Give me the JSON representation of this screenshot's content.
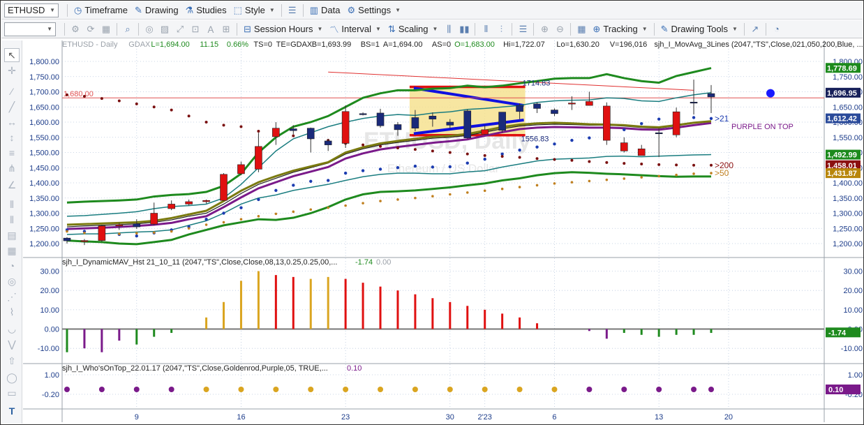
{
  "toolbar1": {
    "symbol": "ETHUSD",
    "timeframe": "Timeframe",
    "drawing": "Drawing",
    "studies": "Studies",
    "style": "Style",
    "data": "Data",
    "settings": "Settings"
  },
  "toolbar2": {
    "session_hours": "Session Hours",
    "interval": "Interval",
    "scaling": "Scaling",
    "tracking": "Tracking",
    "drawing_tools": "Drawing Tools"
  },
  "chart_data": {
    "type": "candlestick",
    "header": {
      "symbol": "ETHUSD - Daily",
      "source": "GDAX",
      "last": "L=1,694.00",
      "change": "11.15",
      "change_pct": "0.66%",
      "ts": "TS=0",
      "te": "TE=GDAX",
      "bid": "B=1,693.99",
      "bs": "BS=1",
      "ask": "A=1,694.00",
      "as": "AS=0",
      "open": "O=1,683.00",
      "high": "Hi=1,722.07",
      "low": "Lo=1,630.20",
      "volume": "V=196,016",
      "study": "sjh_I_MovAvg_3Lines (2047,\"TS\",Close,021,050,200,Blue, ..."
    },
    "watermark": "ETHUSD, Daily",
    "watermark_sub": "Ethereum / US Dollar",
    "price_axis": {
      "min": 1200,
      "max": 1800,
      "ticks": [
        "1,800.00",
        "1,750.00",
        "1,700.00",
        "1,650.00",
        "1,600.00",
        "1,550.00",
        "1,500.00",
        "1,450.00",
        "1,400.00",
        "1,350.00",
        "1,300.00",
        "1,250.00",
        "1,200.00"
      ]
    },
    "price_markers": [
      {
        "label": "1,778.69",
        "value": 1778.69,
        "color": "#1c8a1c"
      },
      {
        "label": "1,696.95",
        "value": 1696.95,
        "color": "#17205a"
      },
      {
        "label": "1,612.42",
        "value": 1612.42,
        "color": "#2a4a9a"
      },
      {
        "label": "1,492.99",
        "value": 1492.99,
        "color": "#1c8a1c"
      },
      {
        "label": "1,458.01",
        "value": 1458.01,
        "color": "#8b1010"
      },
      {
        "label": "1,431.87",
        "value": 1431.87,
        "color": "#b8860b"
      }
    ],
    "hline": {
      "label": "1,680.00",
      "value": 1680,
      "color": "#e05050"
    },
    "annotations": {
      "high_label": "1714.83",
      "low_label": "1556.83",
      "ma21": ">21",
      "ma200": ">200",
      "ma50": ">50",
      "purple_on_top": "PURPLE ON TOP"
    },
    "x_ticks": [
      "9",
      "16",
      "23",
      "30",
      "2'23",
      "6",
      "13",
      "20"
    ],
    "candles": [
      {
        "o": 1209,
        "h": 1221,
        "l": 1200,
        "c": 1218
      },
      {
        "o": 1210,
        "h": 1215,
        "l": 1195,
        "c": 1208
      },
      {
        "o": 1258,
        "h": 1262,
        "l": 1205,
        "c": 1210
      },
      {
        "o": 1262,
        "h": 1268,
        "l": 1245,
        "c": 1258
      },
      {
        "o": 1255,
        "h": 1280,
        "l": 1248,
        "c": 1265
      },
      {
        "o": 1300,
        "h": 1335,
        "l": 1260,
        "c": 1264
      },
      {
        "o": 1330,
        "h": 1342,
        "l": 1310,
        "c": 1315
      },
      {
        "o": 1338,
        "h": 1345,
        "l": 1325,
        "c": 1330
      },
      {
        "o": 1342,
        "h": 1345,
        "l": 1332,
        "c": 1338
      },
      {
        "o": 1428,
        "h": 1432,
        "l": 1340,
        "c": 1342
      },
      {
        "o": 1460,
        "h": 1470,
        "l": 1425,
        "c": 1430
      },
      {
        "o": 1520,
        "h": 1565,
        "l": 1435,
        "c": 1445
      },
      {
        "o": 1580,
        "h": 1600,
        "l": 1525,
        "c": 1552
      },
      {
        "o": 1572,
        "h": 1590,
        "l": 1560,
        "c": 1578
      },
      {
        "o": 1545,
        "h": 1582,
        "l": 1500,
        "c": 1580
      },
      {
        "o": 1525,
        "h": 1545,
        "l": 1505,
        "c": 1538
      },
      {
        "o": 1635,
        "h": 1655,
        "l": 1515,
        "c": 1530
      },
      {
        "o": 1627,
        "h": 1632,
        "l": 1622,
        "c": 1628
      },
      {
        "o": 1588,
        "h": 1644,
        "l": 1582,
        "c": 1630
      },
      {
        "o": 1575,
        "h": 1600,
        "l": 1555,
        "c": 1592
      },
      {
        "o": 1580,
        "h": 1640,
        "l": 1570,
        "c": 1615
      },
      {
        "o": 1610,
        "h": 1632,
        "l": 1585,
        "c": 1620
      },
      {
        "o": 1590,
        "h": 1610,
        "l": 1580,
        "c": 1600
      },
      {
        "o": 1548,
        "h": 1642,
        "l": 1545,
        "c": 1637
      },
      {
        "o": 1575,
        "h": 1590,
        "l": 1558,
        "c": 1560
      },
      {
        "o": 1573,
        "h": 1630,
        "l": 1565,
        "c": 1633
      },
      {
        "o": 1635,
        "h": 1662,
        "l": 1610,
        "c": 1655
      },
      {
        "o": 1645,
        "h": 1665,
        "l": 1630,
        "c": 1660
      },
      {
        "o": 1628,
        "h": 1645,
        "l": 1620,
        "c": 1640
      },
      {
        "o": 1663,
        "h": 1685,
        "l": 1640,
        "c": 1660
      },
      {
        "o": 1668,
        "h": 1700,
        "l": 1655,
        "c": 1655
      },
      {
        "o": 1653,
        "h": 1665,
        "l": 1525,
        "c": 1540
      },
      {
        "o": 1532,
        "h": 1550,
        "l": 1500,
        "c": 1505
      },
      {
        "o": 1512,
        "h": 1525,
        "l": 1490,
        "c": 1490
      },
      {
        "o": 1565,
        "h": 1580,
        "l": 1485,
        "c": 1565
      },
      {
        "o": 1634,
        "h": 1648,
        "l": 1550,
        "c": 1558
      },
      {
        "o": 1666,
        "h": 1740,
        "l": 1625,
        "c": 1666
      },
      {
        "o": 1683,
        "h": 1722,
        "l": 1630,
        "c": 1694
      }
    ],
    "ma_lines": [
      {
        "name": "upper_band",
        "color": "#1e8a1e",
        "width": 3,
        "values": [
          1335,
          1338,
          1340,
          1342,
          1345,
          1355,
          1360,
          1363,
          1370,
          1390,
          1430,
          1500,
          1550,
          1585,
          1600,
          1620,
          1650,
          1680,
          1695,
          1705,
          1705,
          1710,
          1712,
          1720,
          1715,
          1720,
          1728,
          1735,
          1743,
          1745,
          1745,
          1758,
          1745,
          1735,
          1730,
          1752,
          1765,
          1778
        ]
      },
      {
        "name": "upper_teal",
        "color": "#1a7d80",
        "width": 1.5,
        "values": [
          1290,
          1292,
          1296,
          1300,
          1305,
          1315,
          1322,
          1325,
          1330,
          1350,
          1395,
          1450,
          1505,
          1545,
          1565,
          1585,
          1600,
          1612,
          1620,
          1625,
          1622,
          1630,
          1634,
          1642,
          1645,
          1650,
          1655,
          1665,
          1670,
          1672,
          1673,
          1680,
          1678,
          1670,
          1668,
          1680,
          1690,
          1697
        ]
      },
      {
        "name": "ma21_black",
        "color": "#222",
        "width": 1.2,
        "values": [
          1255,
          1258,
          1260,
          1262,
          1265,
          1270,
          1278,
          1290,
          1300,
          1330,
          1365,
          1395,
          1415,
          1435,
          1450,
          1465,
          1495,
          1512,
          1525,
          1533,
          1540,
          1547,
          1550,
          1556,
          1567,
          1578,
          1587,
          1591,
          1593,
          1592,
          1590,
          1590,
          1587,
          1582,
          1580,
          1588,
          1597,
          1604
        ]
      },
      {
        "name": "ma50_purple",
        "color": "#7a1a8a",
        "width": 3,
        "values": [
          1248,
          1250,
          1252,
          1255,
          1258,
          1262,
          1268,
          1280,
          1290,
          1320,
          1352,
          1382,
          1402,
          1422,
          1437,
          1452,
          1480,
          1497,
          1510,
          1518,
          1525,
          1532,
          1537,
          1543,
          1555,
          1567,
          1577,
          1582,
          1584,
          1583,
          1582,
          1582,
          1580,
          1576,
          1575,
          1582,
          1590,
          1597
        ]
      },
      {
        "name": "ma_olive",
        "color": "#7a7a10",
        "width": 3,
        "values": [
          1262,
          1264,
          1266,
          1268,
          1270,
          1275,
          1284,
          1296,
          1308,
          1340,
          1374,
          1402,
          1422,
          1440,
          1454,
          1468,
          1500,
          1517,
          1530,
          1538,
          1545,
          1552,
          1555,
          1561,
          1572,
          1584,
          1592,
          1596,
          1598,
          1596,
          1593,
          1592,
          1590,
          1585,
          1583,
          1590,
          1598,
          1603
        ]
      },
      {
        "name": "lower_teal",
        "color": "#1a7d80",
        "width": 1.5,
        "values": [
          1230,
          1232,
          1232,
          1235,
          1238,
          1240,
          1245,
          1260,
          1275,
          1300,
          1330,
          1350,
          1360,
          1375,
          1385,
          1395,
          1408,
          1420,
          1428,
          1432,
          1432,
          1430,
          1430,
          1436,
          1440,
          1452,
          1462,
          1472,
          1478,
          1480,
          1482,
          1487,
          1488,
          1486,
          1488,
          1490,
          1492,
          1493
        ]
      },
      {
        "name": "lower_band",
        "color": "#1e8a1e",
        "width": 3,
        "values": [
          1210,
          1207,
          1205,
          1200,
          1198,
          1205,
          1212,
          1230,
          1245,
          1260,
          1270,
          1280,
          1278,
          1285,
          1300,
          1320,
          1345,
          1362,
          1370,
          1372,
          1375,
          1380,
          1385,
          1392,
          1398,
          1408,
          1415,
          1425,
          1432,
          1435,
          1433,
          1430,
          1428,
          1425,
          1422,
          1420,
          1421,
          1421
        ]
      }
    ],
    "ma21_dots": {
      "color": "#1c3cb0",
      "values": [
        1245,
        1240,
        1235,
        1230,
        1225,
        1235,
        1245,
        1255,
        1280,
        1300,
        1318,
        1345,
        1375,
        1392,
        1405,
        1408,
        1432,
        1440,
        1445,
        1450,
        1455,
        1452,
        1453,
        1465,
        1478,
        1495,
        1508,
        1518,
        1528,
        1540,
        1548,
        1555,
        1575,
        1595,
        1610,
        1620,
        1615,
        1612
      ]
    },
    "ma200_dots": {
      "color": "#7a1010",
      "values": [
        1690,
        1685,
        1678,
        1670,
        1660,
        1650,
        1640,
        1620,
        1600,
        1590,
        1585,
        1570,
        1560,
        1555,
        1548,
        1540,
        1530,
        1525,
        1520,
        1515,
        1510,
        1505,
        1500,
        1495,
        1490,
        1487,
        1484,
        1480,
        1477,
        1474,
        1470,
        1467,
        1464,
        1462,
        1460,
        1459,
        1458,
        1458
      ]
    },
    "ma50_dots": {
      "color": "#c08020",
      "values": [
        1240,
        1235,
        1230,
        1232,
        1234,
        1236,
        1240,
        1250,
        1262,
        1270,
        1280,
        1290,
        1298,
        1305,
        1312,
        1318,
        1325,
        1333,
        1340,
        1345,
        1350,
        1356,
        1362,
        1368,
        1374,
        1380,
        1386,
        1392,
        1398,
        1402,
        1406,
        1410,
        1414,
        1418,
        1422,
        1426,
        1430,
        1432
      ]
    },
    "highlight_box": {
      "from_index": 20,
      "to_index": 26,
      "top": 1716,
      "bottom": 1557
    },
    "pane2": {
      "label": "sjh_I_DynamicMAV_Hst 21_10_11 (2047,\"TS\",Close,Close,08,13,0.25,0.25,00,...",
      "value1": "-1.74",
      "value2": "0.00",
      "badge": "-1.74",
      "ticks": [
        "30.00",
        "20.00",
        "10.00",
        "0.00",
        "-10.00"
      ],
      "min": -15,
      "max": 32,
      "bars": [
        {
          "v": -12,
          "c": "#1e8a1e"
        },
        {
          "v": -10,
          "c": "#7a1a8a"
        },
        {
          "v": -12,
          "c": "#7a1a8a"
        },
        {
          "v": -6,
          "c": "#7a1a8a"
        },
        {
          "v": -8,
          "c": "#1e8a1e"
        },
        {
          "v": -4,
          "c": "#1e8a1e"
        },
        {
          "v": -2,
          "c": "#1e8a1e"
        },
        {
          "v": 0,
          "c": "#1e8a1e"
        },
        {
          "v": 6,
          "c": "#daa520"
        },
        {
          "v": 14,
          "c": "#daa520"
        },
        {
          "v": 25,
          "c": "#daa520"
        },
        {
          "v": 30,
          "c": "#daa520"
        },
        {
          "v": 28,
          "c": "#e01010"
        },
        {
          "v": 27,
          "c": "#e01010"
        },
        {
          "v": 26,
          "c": "#daa520"
        },
        {
          "v": 27,
          "c": "#daa520"
        },
        {
          "v": 26,
          "c": "#e01010"
        },
        {
          "v": 24,
          "c": "#e01010"
        },
        {
          "v": 22,
          "c": "#e01010"
        },
        {
          "v": 20,
          "c": "#e01010"
        },
        {
          "v": 18,
          "c": "#e01010"
        },
        {
          "v": 16,
          "c": "#e01010"
        },
        {
          "v": 14,
          "c": "#e01010"
        },
        {
          "v": 12,
          "c": "#e01010"
        },
        {
          "v": 10,
          "c": "#e01010"
        },
        {
          "v": 8,
          "c": "#e01010"
        },
        {
          "v": 6,
          "c": "#e01010"
        },
        {
          "v": 3,
          "c": "#e01010"
        },
        {
          "v": 0,
          "c": "#e01010"
        },
        {
          "v": 0,
          "c": "#e01010"
        },
        {
          "v": -1,
          "c": "#7a1a8a"
        },
        {
          "v": -5,
          "c": "#7a1a8a"
        },
        {
          "v": -2,
          "c": "#1e8a1e"
        },
        {
          "v": -3,
          "c": "#1e8a1e"
        },
        {
          "v": -4,
          "c": "#1e8a1e"
        },
        {
          "v": -3,
          "c": "#1e8a1e"
        },
        {
          "v": -3,
          "c": "#1e8a1e"
        },
        {
          "v": -2,
          "c": "#1e8a1e"
        }
      ]
    },
    "pane3": {
      "label": "sjh_I_Who'sOnTop_22.01.17 (2047,\"TS\",Close,Goldenrod,Purple,05, TRUE,...",
      "value": "0.10",
      "badge": "0.10",
      "ticks": [
        "1.00",
        "-0.20"
      ],
      "dots": [
        "#7a1a8a",
        "#7a1a8a",
        "#7a1a8a",
        "#7a1a8a",
        "#7a1a8a",
        "#7a1a8a",
        "#7a1a8a",
        "#daa520",
        "#daa520",
        "#daa520",
        "#daa520",
        "#daa520",
        "#daa520",
        "#daa520",
        "#daa520",
        "#daa520",
        "#daa520",
        "#daa520",
        "#daa520",
        "#daa520",
        "#daa520",
        "#daa520",
        "#daa520",
        "#daa520",
        "#daa520",
        "#daa520",
        "#daa520",
        "#daa520",
        "#daa520",
        "#daa520",
        "#7a1a8a",
        "#7a1a8a",
        "#7a1a8a",
        "#7a1a8a",
        "#7a1a8a",
        "#7a1a8a",
        "#7a1a8a",
        "#7a1a8a"
      ]
    }
  }
}
